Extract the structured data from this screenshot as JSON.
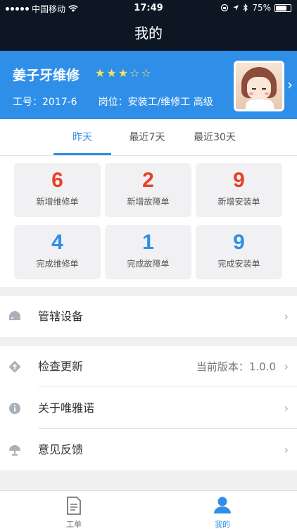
{
  "status_bar": {
    "carrier": "中国移动",
    "time": "17:49",
    "battery": "75%",
    "battery_level": 0.75
  },
  "nav": {
    "title": "我的"
  },
  "profile": {
    "name": "姜子牙维修",
    "rating": 3,
    "rating_max": 5,
    "employee_id": "工号：2017-6",
    "position": "岗位：安装工/维修工 高级"
  },
  "tabs": [
    {
      "label": "昨天",
      "active": true
    },
    {
      "label": "最近7天",
      "active": false
    },
    {
      "label": "最近30天",
      "active": false
    }
  ],
  "stats": [
    {
      "value": "6",
      "label": "新增维修单",
      "color": "#e8402a"
    },
    {
      "value": "2",
      "label": "新增故障单",
      "color": "#e8402a"
    },
    {
      "value": "9",
      "label": "新增安装单",
      "color": "#e8402a"
    },
    {
      "value": "4",
      "label": "完成维修单",
      "color": "#2f8fe8"
    },
    {
      "value": "1",
      "label": "完成故障单",
      "color": "#2f8fe8"
    },
    {
      "value": "9",
      "label": "完成安装单",
      "color": "#2f8fe8"
    }
  ],
  "menu": {
    "devices": {
      "label": "管辖设备",
      "icon": "device-icon"
    },
    "update": {
      "label": "检查更新",
      "value": "当前版本：1.0.0",
      "icon": "update-icon"
    },
    "about": {
      "label": "关于唯雅诺",
      "icon": "info-icon"
    },
    "feedback": {
      "label": "意见反馈",
      "icon": "feedback-icon"
    }
  },
  "tabbar": {
    "orders": {
      "label": "工单",
      "icon": "document-icon"
    },
    "mine": {
      "label": "我的",
      "icon": "user-icon"
    }
  },
  "colors": {
    "header_bg": "#0d1724",
    "accent": "#2f8fe8",
    "red": "#e8402a",
    "star": "#ffe15a"
  }
}
